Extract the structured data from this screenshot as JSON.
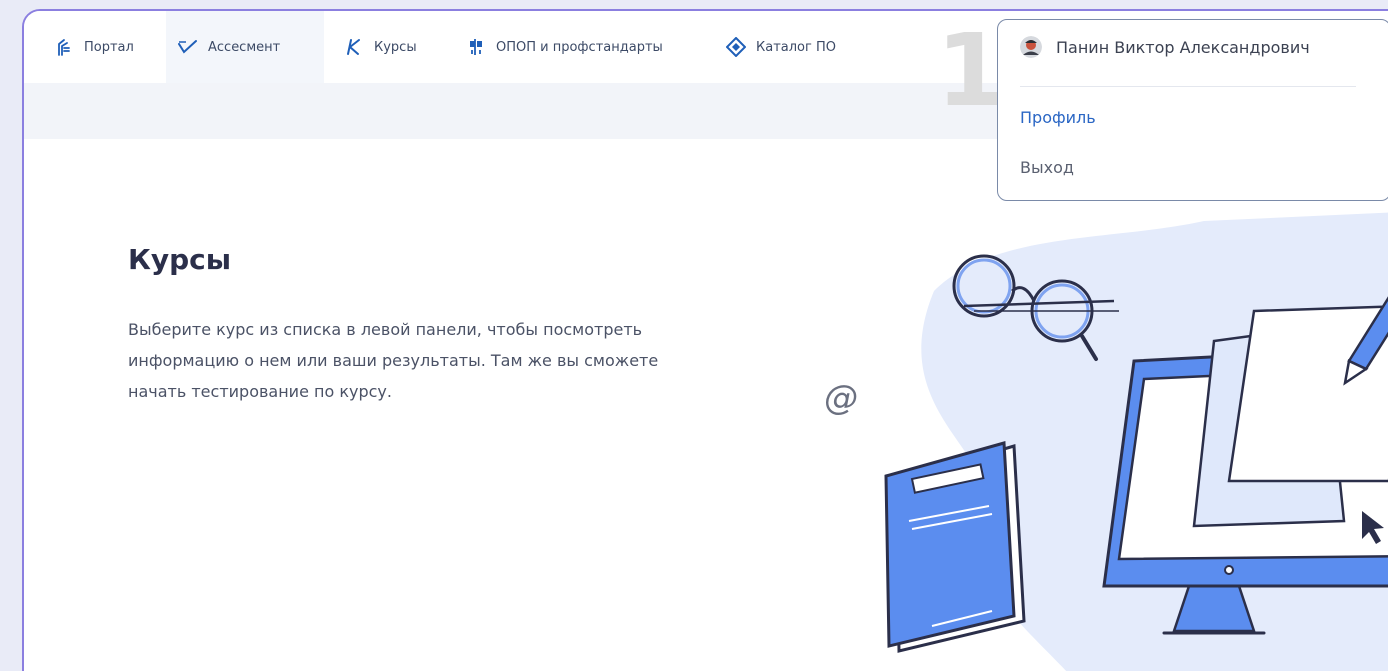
{
  "nav": {
    "items": [
      {
        "label": "Портал",
        "icon": "portal-icon"
      },
      {
        "label": "Ассесмент",
        "icon": "assessment-check-icon"
      },
      {
        "label": "Курсы",
        "icon": "courses-k-icon"
      },
      {
        "label": "ОПОП и профстандарты",
        "icon": "standards-icon"
      },
      {
        "label": "Каталог ПО",
        "icon": "catalog-diamond-icon"
      }
    ],
    "active": "Ассесмент"
  },
  "step_marker": "1",
  "main": {
    "title": "Курсы",
    "description_lines": [
      "Выберите курс из списка в левой панели, чтобы посмотреть",
      "информацию о нем или ваши результаты. Там же вы сможете",
      "начать тестирование по курсу."
    ]
  },
  "user_menu": {
    "name": "Панин Виктор Александрович",
    "items": [
      "Профиль",
      "Выход"
    ]
  },
  "illustration": {
    "at_symbol": "@"
  },
  "colors": {
    "accent_blue": "#5b8def",
    "nav_icon_blue": "#1f5fb8",
    "frame_purple": "#8b7fe0",
    "blob_light": "#e4ebfb",
    "profile_link": "#2a66c4"
  }
}
